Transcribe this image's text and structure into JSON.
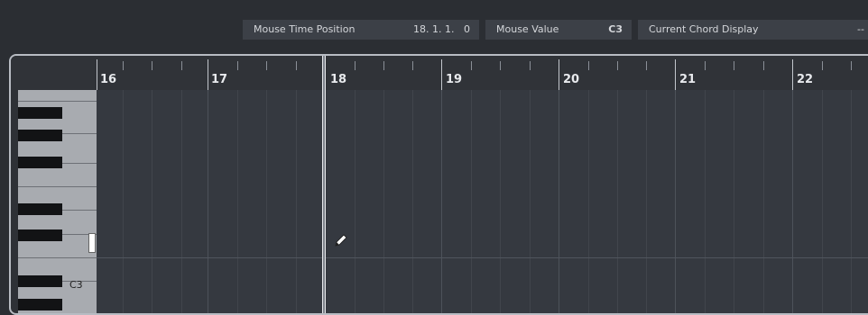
{
  "info_bar": {
    "mouse_time_position": {
      "label": "Mouse Time Position",
      "value": "18. 1. 1.   0"
    },
    "mouse_value": {
      "label": "Mouse Value",
      "value": "C3"
    },
    "current_chord_display": {
      "label": "Current Chord Display",
      "value": "--"
    }
  },
  "ruler": {
    "bars": [
      "16",
      "17",
      "18",
      "19",
      "20",
      "21",
      "22"
    ]
  },
  "keyboard": {
    "c3_label": "C3"
  },
  "tool": {
    "icon": "pencil-icon"
  },
  "colors": {
    "background": "#2b2e33",
    "field_bg": "#3c4047",
    "grid_bg": "#353940",
    "keyboard": "#a8abb0"
  }
}
